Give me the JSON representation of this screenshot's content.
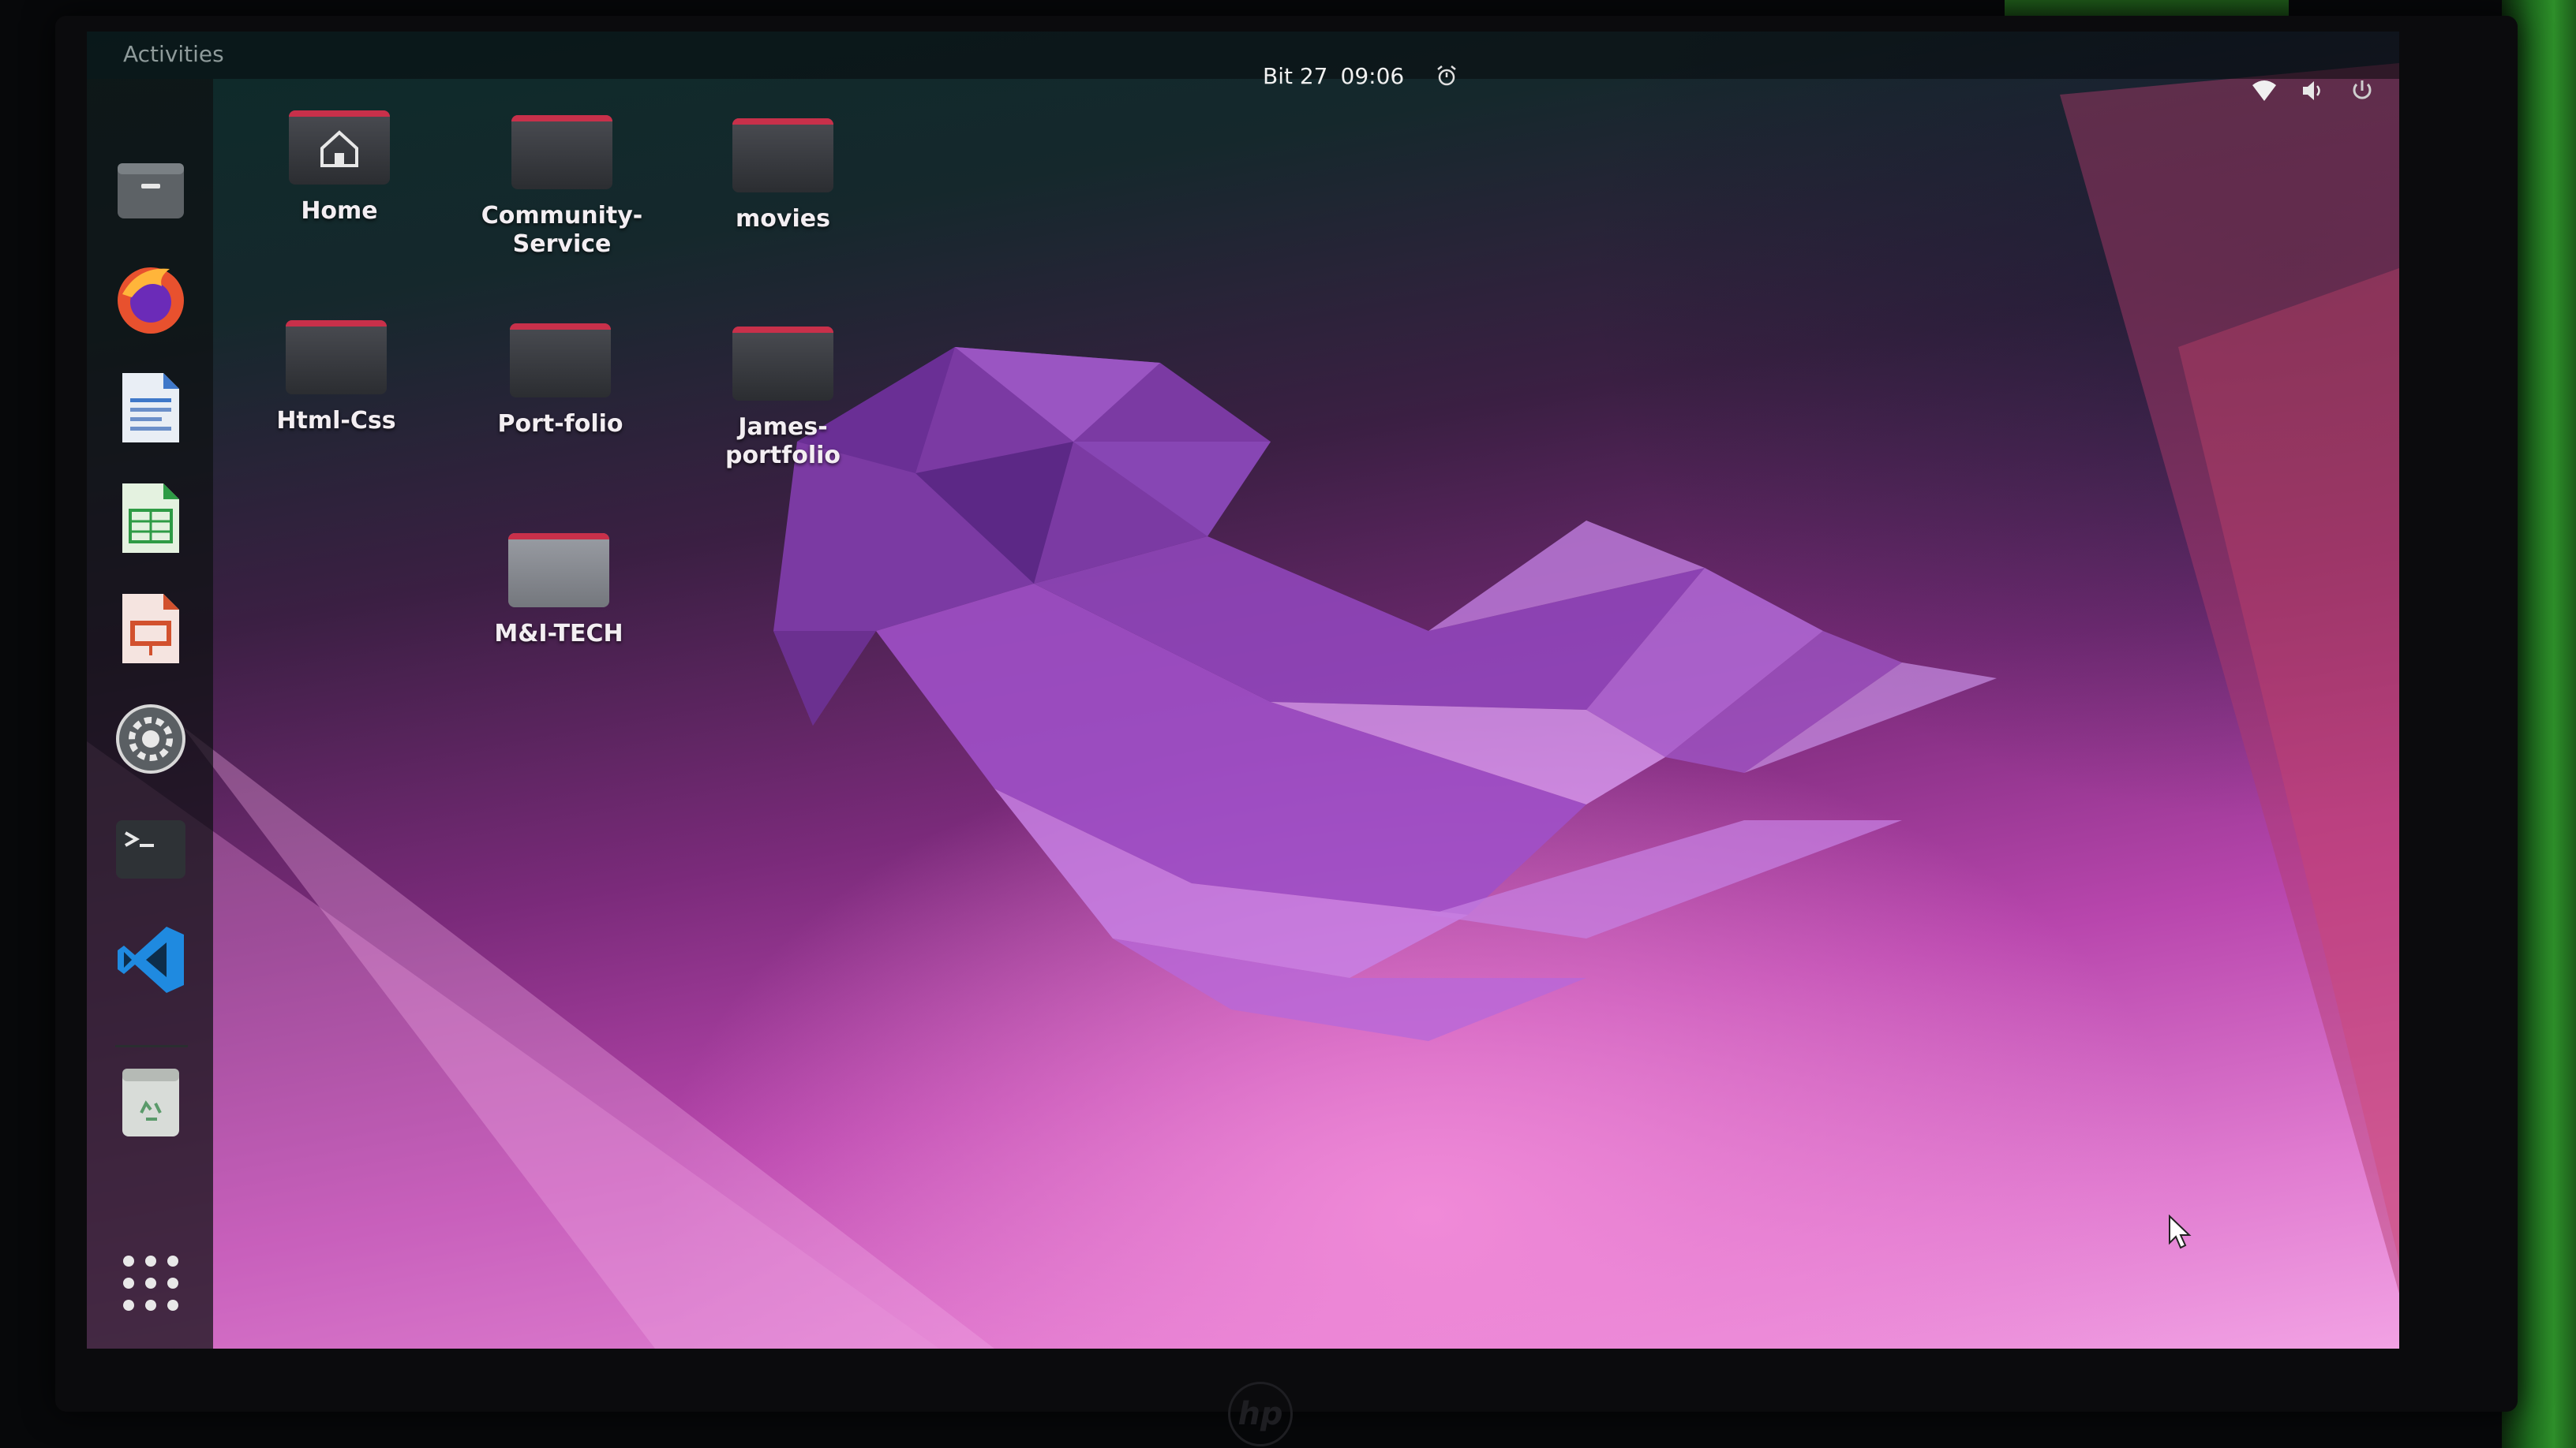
{
  "topbar": {
    "activities_label": "Activities",
    "date": "Bit 27",
    "time": "09:06"
  },
  "tray": {
    "icons": [
      "wifi-icon",
      "volume-icon",
      "power-icon"
    ]
  },
  "dock": {
    "apps": [
      "Files",
      "Firefox",
      "LibreOffice Writer",
      "LibreOffice Calc",
      "LibreOffice Impress",
      "Settings",
      "Terminal",
      "Visual Studio Code",
      "Trash",
      "Show Applications"
    ]
  },
  "desktop": {
    "icons": [
      {
        "label": "Home"
      },
      {
        "label": "Community-\nService"
      },
      {
        "label": "movies"
      },
      {
        "label": "Html-Css"
      },
      {
        "label": "Port-folio"
      },
      {
        "label": "James-portfolio"
      },
      {
        "label": "M&I-TECH"
      }
    ]
  },
  "colors": {
    "folder_accent": "#c8304a",
    "wallpaper_magenta": "#b846ad",
    "vscode_blue": "#1f8ae0"
  }
}
